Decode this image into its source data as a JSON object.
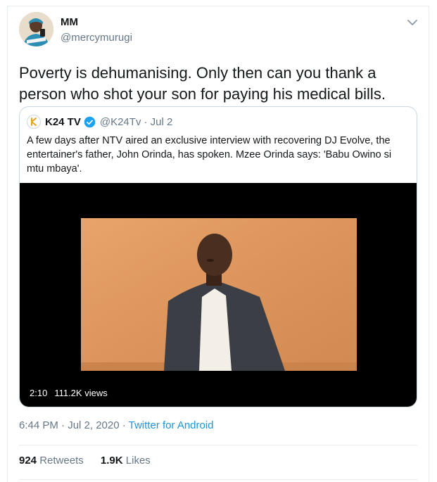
{
  "author": {
    "display_name": "MM",
    "handle": "@mercymurugi"
  },
  "tweet": {
    "text": "Poverty is dehumanising. Only then can you thank a person who shot your son for paying his medical bills."
  },
  "quoted_tweet": {
    "display_name": "K24 TV",
    "handle": "@K24Tv",
    "date": "· Jul 2",
    "text": "A few days after NTV aired an exclusive interview with recovering DJ Evolve, the entertainer's father, John Orinda, has spoken. Mzee Orinda says: 'Babu Owino si mtu mbaya'.",
    "video": {
      "duration": "2:10",
      "views": "111.2K views"
    }
  },
  "meta": {
    "time": "6:44 PM · Jul 2, 2020 · ",
    "source": "Twitter for Android"
  },
  "stats": {
    "retweets_count": "924",
    "retweets_label": "Retweets",
    "likes_count": "1.9K",
    "likes_label": "Likes"
  },
  "colors": {
    "link": "#1b95e0",
    "secondary_text": "#657786",
    "verified": "#1da1f2"
  }
}
